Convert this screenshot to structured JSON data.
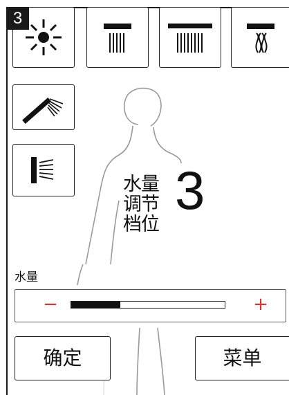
{
  "header": {
    "step_number": "3"
  },
  "modes": [
    {
      "icon": "sun-icon"
    },
    {
      "icon": "rain-shower-icon"
    },
    {
      "icon": "wide-rain-shower-icon"
    },
    {
      "icon": "waterfall-shower-icon"
    },
    {
      "icon": "hand-shower-icon"
    },
    {
      "icon": "side-jet-icon"
    }
  ],
  "center": {
    "label_line1": "水量",
    "label_line2": "调节",
    "label_line3": "档位",
    "level": "3"
  },
  "volume": {
    "label": "水量",
    "minus": "−",
    "plus": "+",
    "level_fraction": 0.32
  },
  "buttons": {
    "confirm": "确定",
    "menu": "菜单"
  },
  "colors": {
    "accent": "#e03131",
    "ink": "#111111"
  }
}
